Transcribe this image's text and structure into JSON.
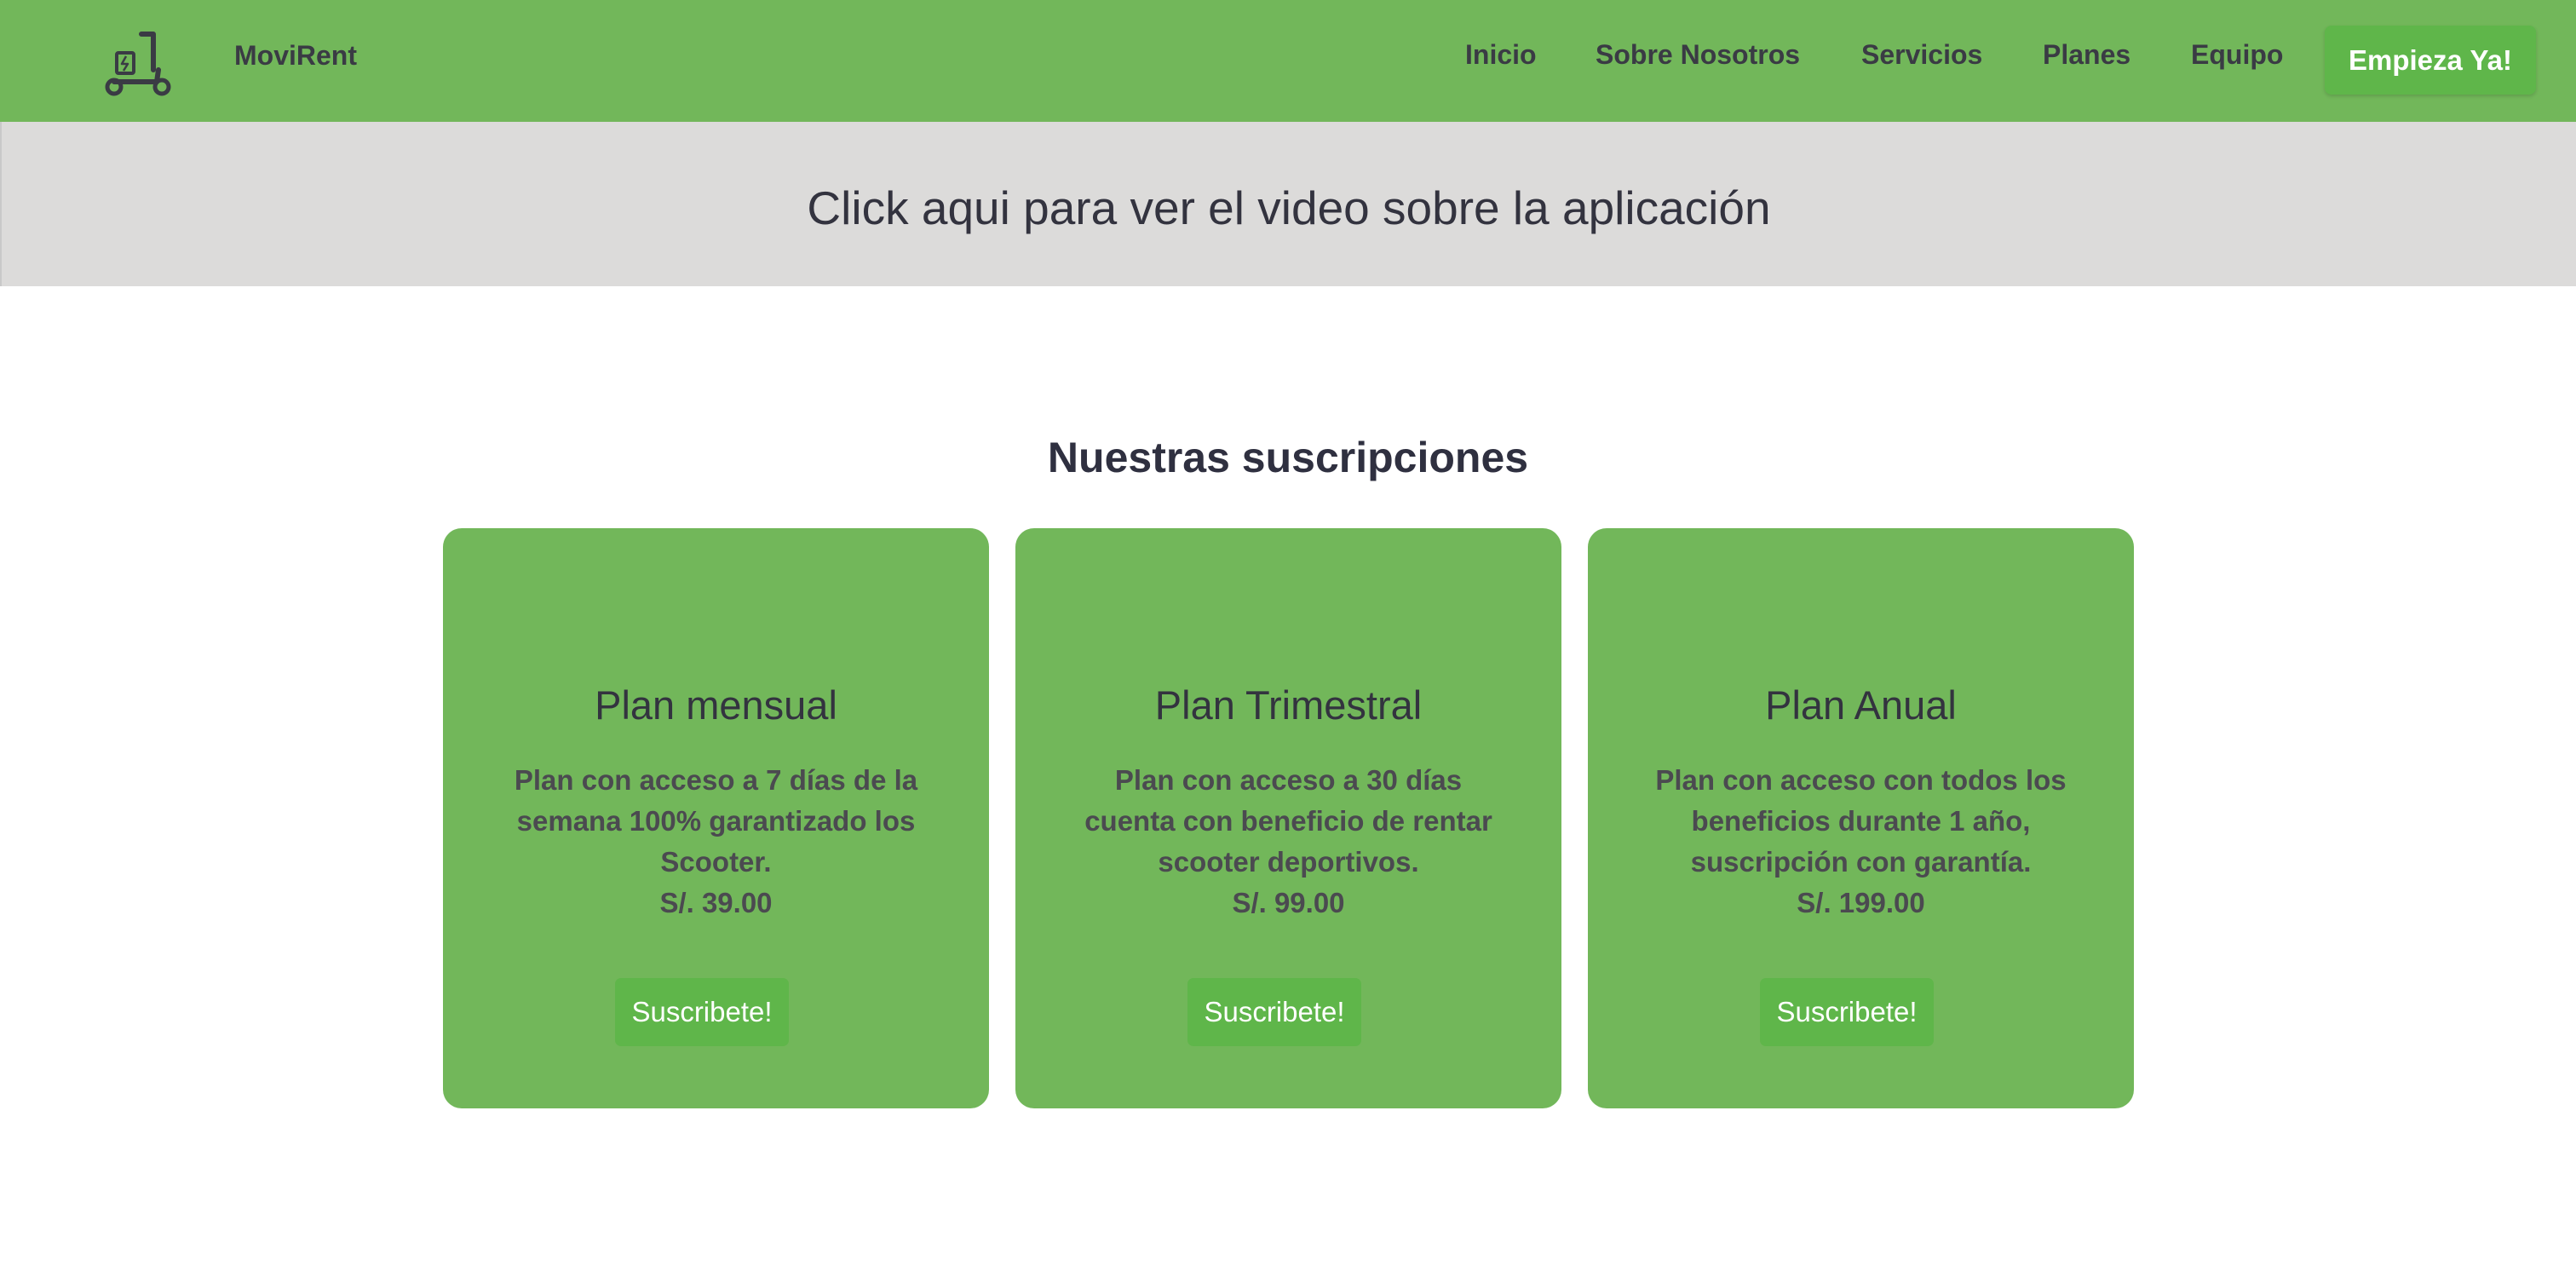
{
  "navbar": {
    "brand": "MoviRent",
    "logo_icon": "scooter-icon",
    "links": [
      "Inicio",
      "Sobre Nosotros",
      "Servicios",
      "Planes",
      "Equipo"
    ],
    "cta_label": "Empieza Ya!"
  },
  "video_banner": {
    "text": "Click aqui para ver el video sobre la aplicación"
  },
  "subscriptions": {
    "title": "Nuestras suscripciones",
    "plans": [
      {
        "name": "Plan mensual",
        "description": "Plan con acceso a 7 días de la semana 100% garantizado los Scooter.",
        "price": "S/. 39.00",
        "button_label": "Suscribete!"
      },
      {
        "name": "Plan Trimestral",
        "description": "Plan con acceso a 30 días cuenta con beneficio de rentar scooter deportivos.",
        "price": "S/. 99.00",
        "button_label": "Suscribete!"
      },
      {
        "name": "Plan Anual",
        "description": "Plan con acceso con todos los beneficios durante 1 año, suscripción con garantía.",
        "price": "S/. 199.00",
        "button_label": "Suscribete!"
      }
    ]
  },
  "colors": {
    "navbar_bg": "#72b75a",
    "button_green": "#5fb64a",
    "banner_bg": "#dcdbda",
    "text_dark": "#33333f"
  }
}
